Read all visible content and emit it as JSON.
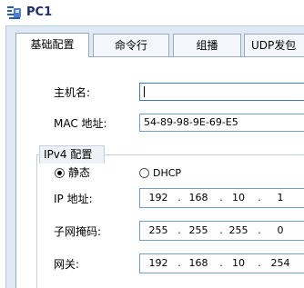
{
  "window": {
    "title": "PC1",
    "icon": "pc-network-icon"
  },
  "tabs": [
    {
      "label": "基础配置",
      "active": true
    },
    {
      "label": "命令行",
      "active": false
    },
    {
      "label": "组播",
      "active": false
    },
    {
      "label": "UDP发包工",
      "active": false
    }
  ],
  "basic": {
    "hostname_label": "主机名:",
    "hostname_value": "",
    "mac_label": "MAC 地址:",
    "mac_value": "54-89-98-9E-69-E5"
  },
  "ipv4": {
    "legend": "IPv4 配置",
    "static_label": "静态",
    "dhcp_label": "DHCP",
    "selected": "static",
    "ip_label": "IP 地址:",
    "ip": [
      "192",
      "168",
      "10",
      "1"
    ],
    "mask_label": "子网掩码:",
    "mask": [
      "255",
      "255",
      "255",
      "0"
    ],
    "gateway_label": "网关:",
    "gateway": [
      "192",
      "168",
      "10",
      "254"
    ],
    "octet_separator": "."
  },
  "colors": {
    "title": "#1e2f6b",
    "frame": "#dfe9f5",
    "field_border": "#7a9cc4"
  }
}
